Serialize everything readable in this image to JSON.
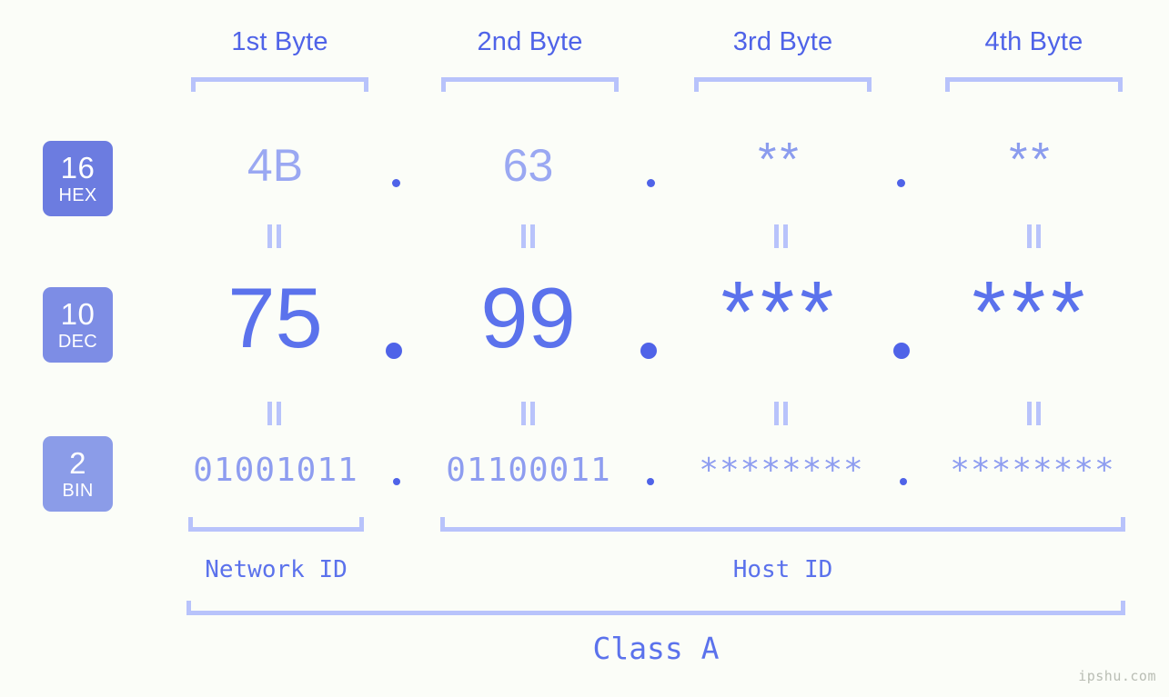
{
  "page": {
    "background_color": "#fbfdf8",
    "accent_color": "#4f63e8",
    "bracket_color": "#b8c3fb",
    "watermark": "ipshu.com"
  },
  "header": {
    "byte_labels": [
      {
        "label": "1st Byte"
      },
      {
        "label": "2nd Byte"
      },
      {
        "label": "3rd Byte"
      },
      {
        "label": "4th Byte"
      }
    ]
  },
  "bases": [
    {
      "number": "16",
      "name": "HEX",
      "color": "#6c7ce0"
    },
    {
      "number": "10",
      "name": "DEC",
      "color": "#7d8de5"
    },
    {
      "number": "2",
      "name": "BIN",
      "color": "#8b9ce8"
    }
  ],
  "rows": {
    "hex": {
      "base_number": "16",
      "base_name": "HEX",
      "values": [
        "4B",
        "63",
        "**",
        "**"
      ],
      "separator": "."
    },
    "dec": {
      "base_number": "10",
      "base_name": "DEC",
      "values": [
        "75",
        "99",
        "***",
        "***"
      ],
      "separator": "."
    },
    "bin": {
      "base_number": "2",
      "base_name": "BIN",
      "values": [
        "01001011",
        "01100011",
        "********",
        "********"
      ],
      "separator": "."
    }
  },
  "equals_separators": {
    "glyph": "=",
    "count_per_gap": 4
  },
  "sections": {
    "network_id": "Network ID",
    "host_id": "Host ID",
    "class": "Class A"
  }
}
